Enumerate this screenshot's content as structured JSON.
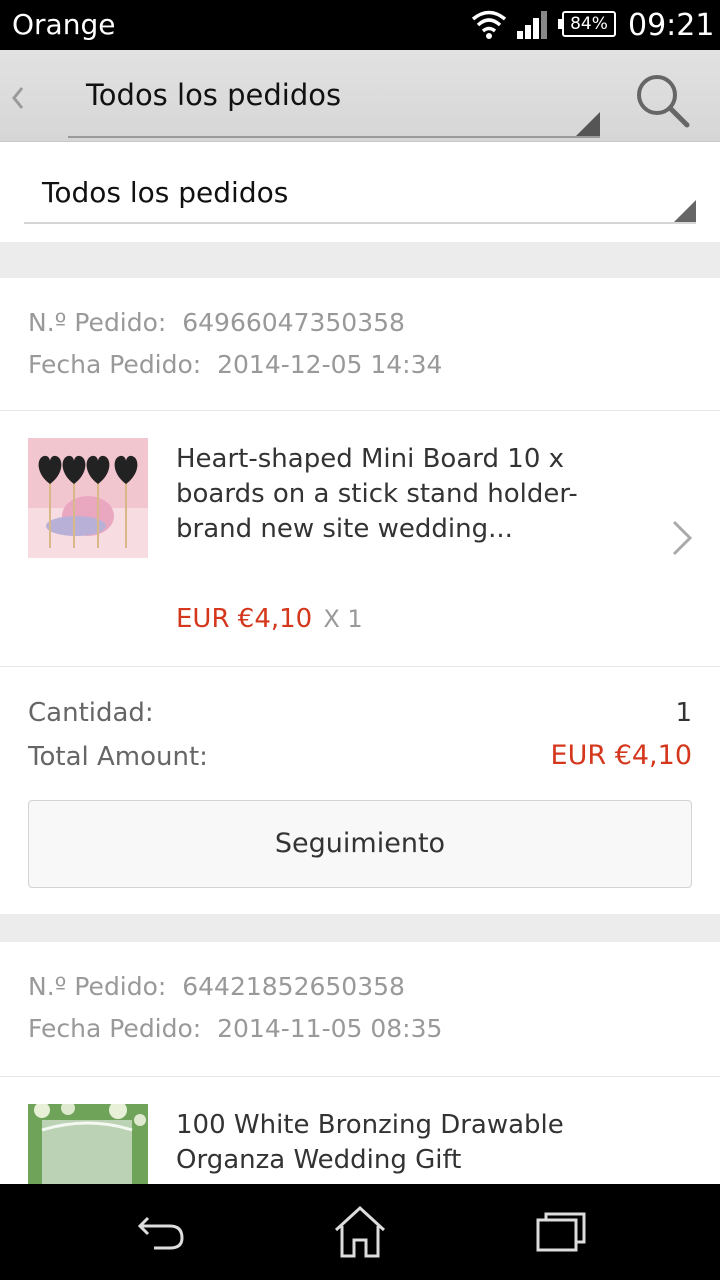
{
  "status_bar": {
    "carrier": "Orange",
    "battery": "84%",
    "time": "09:21"
  },
  "header": {
    "title": "Todos los pedidos"
  },
  "filter": {
    "selected": "Todos los pedidos"
  },
  "orders": [
    {
      "order_no_label": "N.º Pedido:",
      "order_no": "64966047350358",
      "date_label": "Fecha Pedido:",
      "date": "2014-12-05 14:34",
      "product_title": "Heart-shaped Mini Board 10 x boards on a stick stand holder-brand new site  wedding...",
      "price": "EUR €4,10",
      "qty": "X 1",
      "quantity_label": "Cantidad:",
      "quantity": "1",
      "total_label": "Total Amount:",
      "total": "EUR €4,10",
      "track_label": "Seguimiento"
    },
    {
      "order_no_label": "N.º Pedido:",
      "order_no": "64421852650358",
      "date_label": "Fecha Pedido:",
      "date": "2014-11-05 08:35",
      "product_title": "100 White Bronzing Drawable Organza Wedding Gift"
    }
  ],
  "colors": {
    "accent_price": "#d4371c",
    "action_bar": "#dcdcdc",
    "background": "#ececec"
  },
  "icons": [
    "wifi-icon",
    "signal-icon",
    "battery-icon",
    "back-chevron-icon",
    "search-icon",
    "dropdown-triangle-icon",
    "chevron-right-icon",
    "nav-back-icon",
    "nav-home-icon",
    "nav-recents-icon"
  ]
}
